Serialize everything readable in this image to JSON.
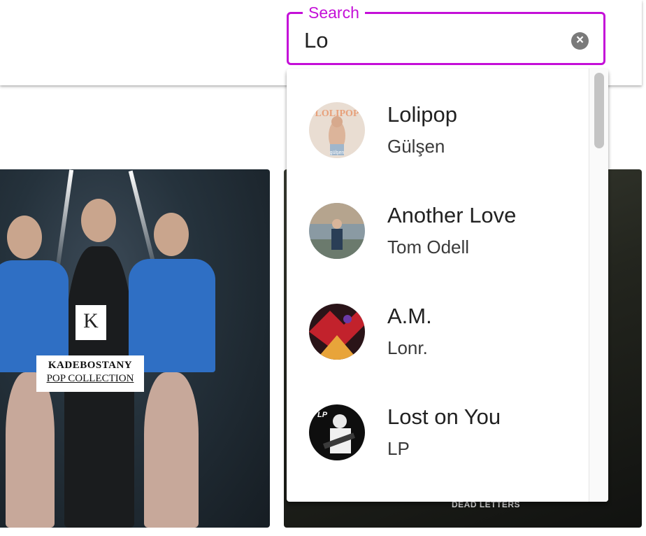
{
  "search": {
    "label": "Search",
    "value": "Lo",
    "accent_color": "#c40fd8",
    "clear_icon": "clear-icon"
  },
  "results": [
    {
      "title": "Lolipop",
      "artist": "Gülşen"
    },
    {
      "title": "Another Love",
      "artist": "Tom Odell"
    },
    {
      "title": "A.M.",
      "artist": "Lonr."
    },
    {
      "title": "Lost on You",
      "artist": "LP"
    }
  ],
  "cards": {
    "left": {
      "logo_mark": "K",
      "line1": "KADEBOSTANY",
      "line2": "POP COLLECTION"
    },
    "right": {
      "caption": "DEAD LETTERS"
    }
  },
  "thumbnail_art": {
    "lolipop_cover": "gülşen"
  }
}
